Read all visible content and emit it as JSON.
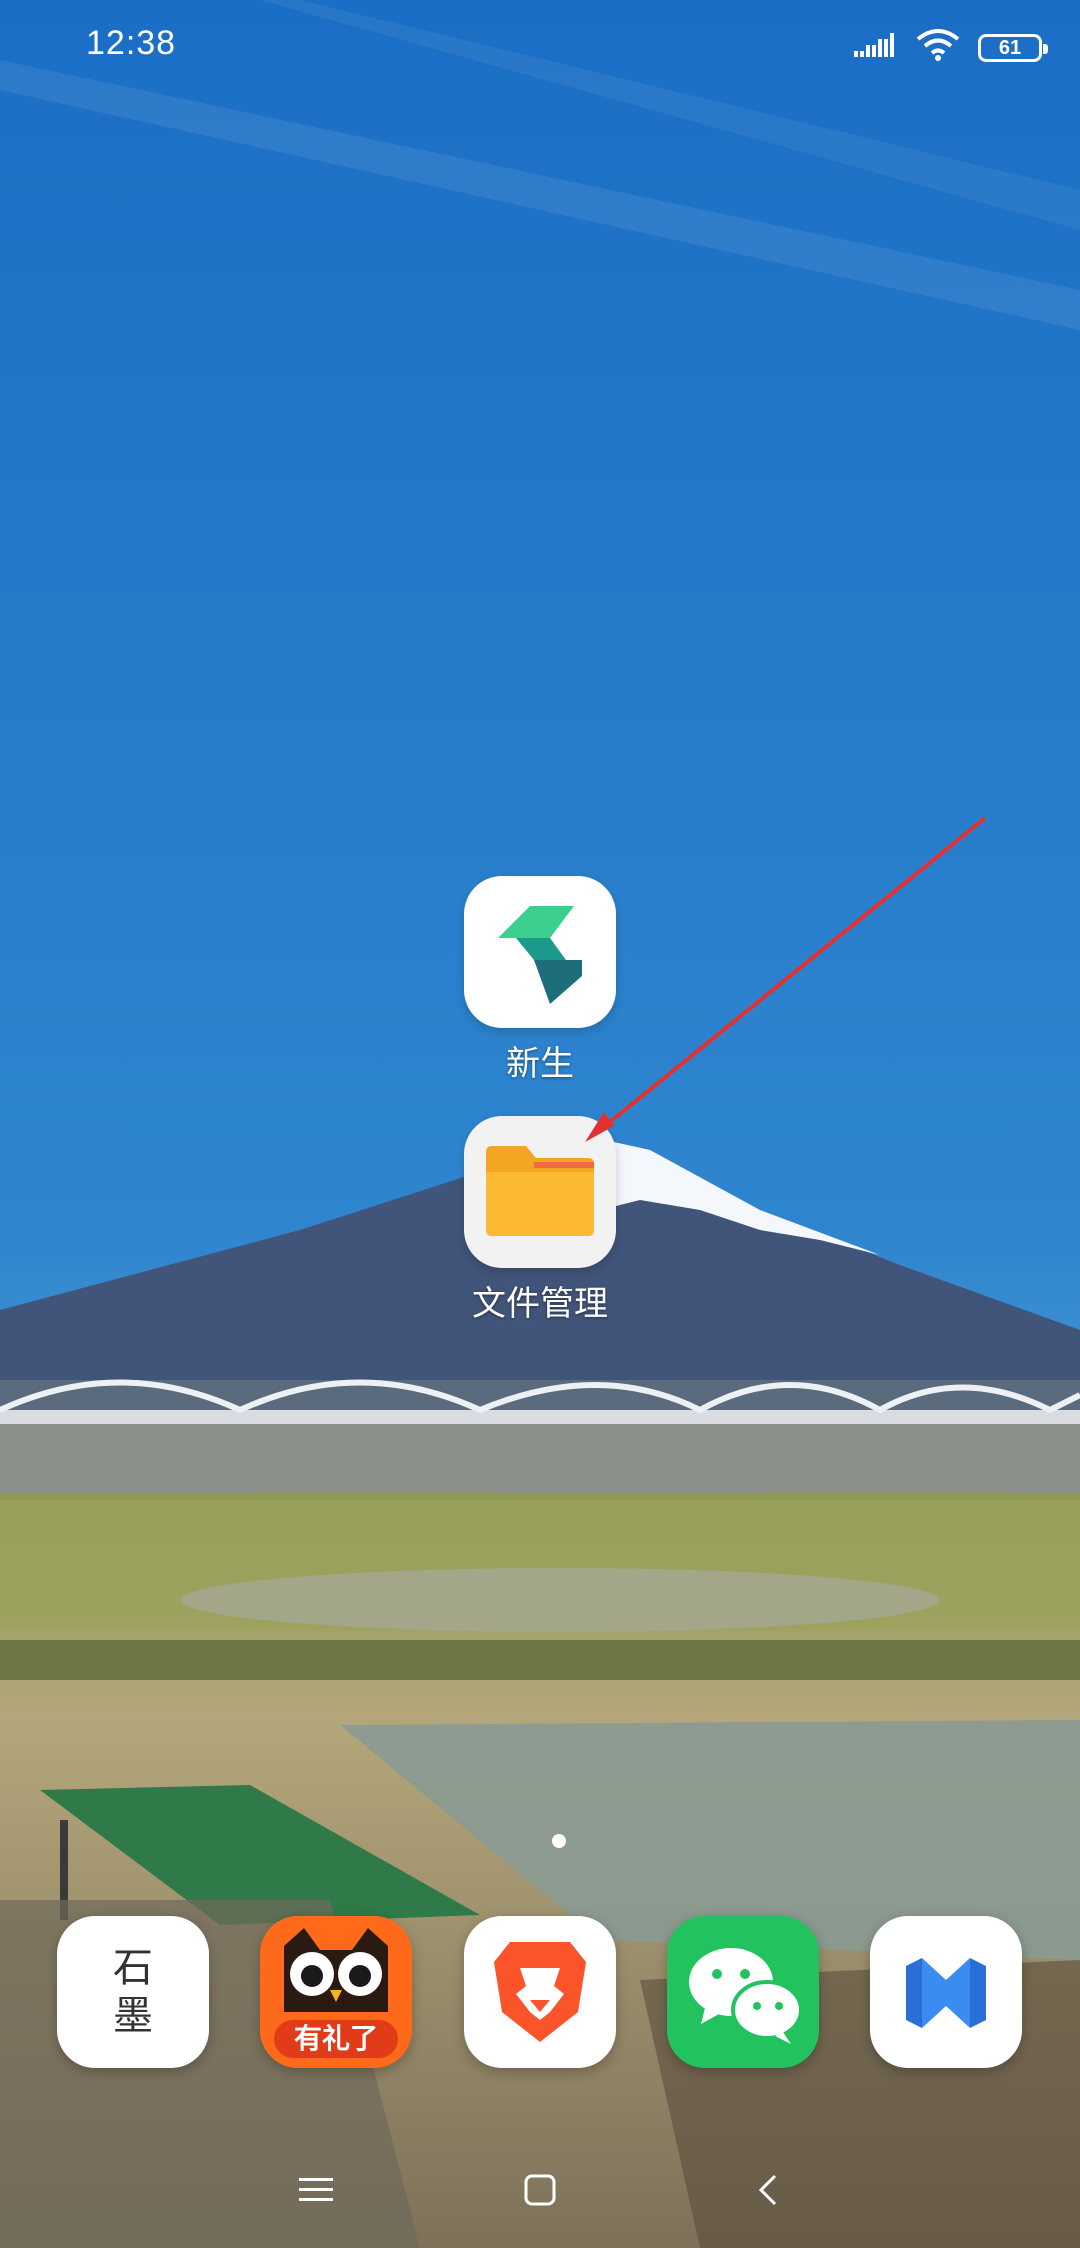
{
  "status_bar": {
    "time": "12:38",
    "battery_level": "61",
    "signal_icon": "signal-icon",
    "wifi_icon": "wifi-icon"
  },
  "home": {
    "apps": [
      {
        "label": "新生",
        "icon": "xinsheng-app-icon"
      },
      {
        "label": "文件管理",
        "icon": "folder-icon"
      }
    ],
    "page_indicator": {
      "current_page": 1,
      "total_pages": 1
    }
  },
  "dock": {
    "apps": [
      {
        "name": "石墨",
        "icon_text": "石\n墨"
      },
      {
        "name": "owl-app",
        "icon_text": "有礼了"
      },
      {
        "name": "brave",
        "icon": "lion-icon"
      },
      {
        "name": "wechat",
        "icon": "wechat-icon"
      },
      {
        "name": "blue-app",
        "icon": "m-logo-icon"
      }
    ]
  },
  "nav_bar": {
    "menu_icon": "menu-icon",
    "home_icon": "home-square-icon",
    "back_icon": "back-chevron-icon"
  },
  "colors": {
    "sky_top": "#1f73c9",
    "sky_bottom": "#4a95cf",
    "folder_orange": "#f7b02a",
    "annotation_arrow": "#e53030",
    "wechat_green": "#22c35e",
    "brave_orange": "#fb542b",
    "owl_orange": "#ff6a1a"
  }
}
